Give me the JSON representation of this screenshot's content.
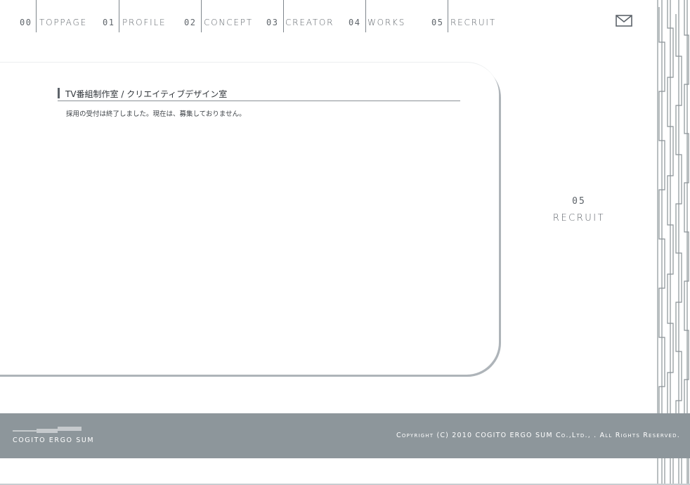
{
  "nav": {
    "items": [
      {
        "num": "00",
        "label": "TOPPAGE"
      },
      {
        "num": "01",
        "label": "PROFILE"
      },
      {
        "num": "02",
        "label": "CONCEPT"
      },
      {
        "num": "03",
        "label": "CREATOR"
      },
      {
        "num": "04",
        "label": "WORKS"
      },
      {
        "num": "05",
        "label": "RECRUIT"
      }
    ],
    "mail_icon": "mail-envelope-icon"
  },
  "content": {
    "section_title": "TV番組制作室 / クリエイティブデザイン室",
    "body": "採用の受付は終了しました。現在は、募集しておりません。"
  },
  "page_label": {
    "number": "05",
    "name": "RECRUIT"
  },
  "footer": {
    "logo_text": "COGITO ERGO SUM",
    "copyright": "Copyright (C) 2010 COGITO ERGO SUM Co.,Ltd., . All Rights Reserved."
  },
  "colors": {
    "footer_bg": "#8d969b",
    "nav_text": "#5f656b",
    "pattern_stroke": "#8a9297"
  }
}
